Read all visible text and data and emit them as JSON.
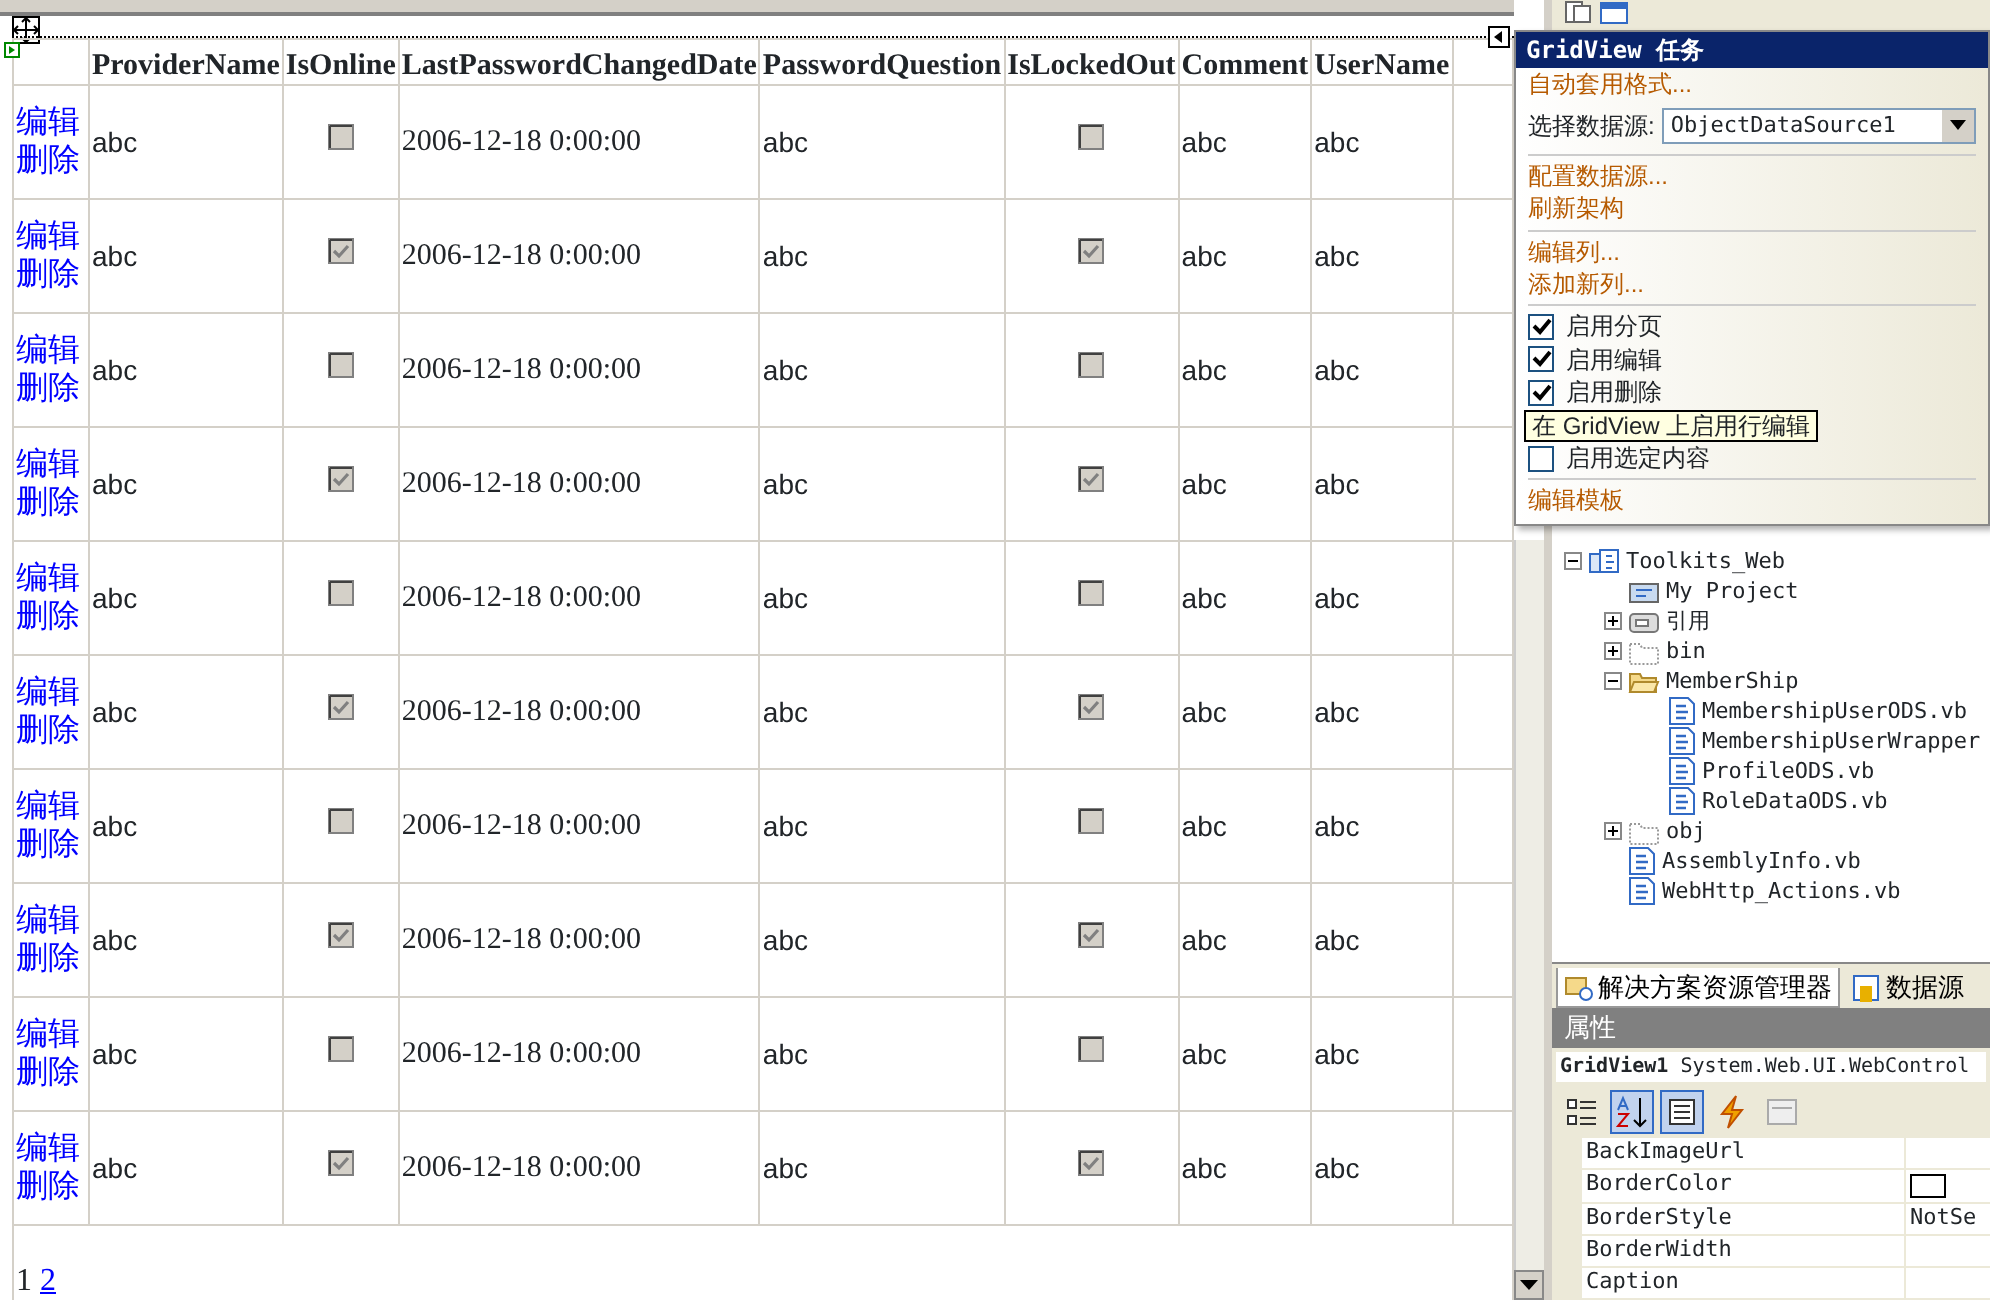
{
  "grid": {
    "columns": [
      "ProviderName",
      "IsOnline",
      "LastPasswordChangedDate",
      "PasswordQuestion",
      "IsLockedOut",
      "Comment",
      "UserName"
    ],
    "rows": [
      {
        "edit_link": "编辑",
        "delete_link": "删除",
        "provider_name": "abc",
        "is_online": false,
        "last_password_changed_date": "2006-12-18 0:00:00",
        "password_question": "abc",
        "is_locked_out": false,
        "comment": "abc",
        "user_name": "abc"
      },
      {
        "edit_link": "编辑",
        "delete_link": "删除",
        "provider_name": "abc",
        "is_online": true,
        "last_password_changed_date": "2006-12-18 0:00:00",
        "password_question": "abc",
        "is_locked_out": true,
        "comment": "abc",
        "user_name": "abc"
      },
      {
        "edit_link": "编辑",
        "delete_link": "删除",
        "provider_name": "abc",
        "is_online": false,
        "last_password_changed_date": "2006-12-18 0:00:00",
        "password_question": "abc",
        "is_locked_out": false,
        "comment": "abc",
        "user_name": "abc"
      },
      {
        "edit_link": "编辑",
        "delete_link": "删除",
        "provider_name": "abc",
        "is_online": true,
        "last_password_changed_date": "2006-12-18 0:00:00",
        "password_question": "abc",
        "is_locked_out": true,
        "comment": "abc",
        "user_name": "abc"
      },
      {
        "edit_link": "编辑",
        "delete_link": "删除",
        "provider_name": "abc",
        "is_online": false,
        "last_password_changed_date": "2006-12-18 0:00:00",
        "password_question": "abc",
        "is_locked_out": false,
        "comment": "abc",
        "user_name": "abc"
      },
      {
        "edit_link": "编辑",
        "delete_link": "删除",
        "provider_name": "abc",
        "is_online": true,
        "last_password_changed_date": "2006-12-18 0:00:00",
        "password_question": "abc",
        "is_locked_out": true,
        "comment": "abc",
        "user_name": "abc"
      },
      {
        "edit_link": "编辑",
        "delete_link": "删除",
        "provider_name": "abc",
        "is_online": false,
        "last_password_changed_date": "2006-12-18 0:00:00",
        "password_question": "abc",
        "is_locked_out": false,
        "comment": "abc",
        "user_name": "abc"
      },
      {
        "edit_link": "编辑",
        "delete_link": "删除",
        "provider_name": "abc",
        "is_online": true,
        "last_password_changed_date": "2006-12-18 0:00:00",
        "password_question": "abc",
        "is_locked_out": true,
        "comment": "abc",
        "user_name": "abc"
      },
      {
        "edit_link": "编辑",
        "delete_link": "删除",
        "provider_name": "abc",
        "is_online": false,
        "last_password_changed_date": "2006-12-18 0:00:00",
        "password_question": "abc",
        "is_locked_out": false,
        "comment": "abc",
        "user_name": "abc"
      },
      {
        "edit_link": "编辑",
        "delete_link": "删除",
        "provider_name": "abc",
        "is_online": true,
        "last_password_changed_date": "2006-12-18 0:00:00",
        "password_question": "abc",
        "is_locked_out": true,
        "comment": "abc",
        "user_name": "abc"
      }
    ],
    "pager": [
      {
        "label": "1",
        "selected": true
      },
      {
        "label": "2",
        "selected": false
      }
    ]
  },
  "task_panel": {
    "title": "GridView 任务",
    "items": [
      {
        "kind": "link",
        "label": "自动套用格式..."
      },
      {
        "kind": "select",
        "label": "选择数据源:",
        "value": "ObjectDataSource1"
      },
      {
        "kind": "separator"
      },
      {
        "kind": "link",
        "label": "配置数据源..."
      },
      {
        "kind": "link",
        "label": "刷新架构"
      },
      {
        "kind": "separator"
      },
      {
        "kind": "link",
        "label": "编辑列..."
      },
      {
        "kind": "link",
        "label": "添加新列..."
      },
      {
        "kind": "separator"
      },
      {
        "kind": "checkbox",
        "label": "启用分页",
        "checked": true
      },
      {
        "kind": "checkbox",
        "label": "启用编辑",
        "checked": true
      },
      {
        "kind": "checkbox",
        "label": "启用删除",
        "checked": true
      },
      {
        "kind": "tooltip",
        "label": "在 GridView 上启用行编辑"
      },
      {
        "kind": "checkbox",
        "label": "启用选定内容",
        "checked": false
      },
      {
        "kind": "separator"
      },
      {
        "kind": "link",
        "label": "编辑模板"
      }
    ]
  },
  "solution_explorer": {
    "tree": [
      {
        "kind": "project",
        "label": "Toolkits_Web",
        "expanded": true,
        "children": [
          {
            "kind": "properties",
            "label": "My Project"
          },
          {
            "kind": "references",
            "label": "引用",
            "expanded": false
          },
          {
            "kind": "folder",
            "label": "bin",
            "expanded": false
          },
          {
            "kind": "folder",
            "label": "MemberShip",
            "expanded": true,
            "children": [
              {
                "kind": "file",
                "label": "MembershipUserODS.vb"
              },
              {
                "kind": "file",
                "label": "MembershipUserWrapper"
              },
              {
                "kind": "file",
                "label": "ProfileODS.vb"
              },
              {
                "kind": "file",
                "label": "RoleDataODS.vb"
              }
            ]
          },
          {
            "kind": "folder",
            "label": "obj",
            "expanded": false
          },
          {
            "kind": "file",
            "label": "AssemblyInfo.vb"
          },
          {
            "kind": "file",
            "label": "WebHttp_Actions.vb"
          }
        ]
      }
    ],
    "tabs": [
      {
        "label": "解决方案资源管理器",
        "selected": true
      },
      {
        "label": "数据源",
        "selected": false
      }
    ]
  },
  "properties": {
    "title": "属性",
    "object_name": "GridView1",
    "object_type": "System.Web.UI.WebControl",
    "toolbar": [
      {
        "kind": "categorized",
        "selected": false
      },
      {
        "kind": "alphabetical",
        "selected": true
      },
      {
        "kind": "properties",
        "selected": true
      },
      {
        "kind": "events",
        "selected": false
      },
      {
        "kind": "pages",
        "selected": false
      }
    ],
    "rows": [
      {
        "name": "BackImageUrl"
      },
      {
        "name": "BorderColor",
        "kind": "color"
      },
      {
        "name": "BorderStyle",
        "value": "NotSe"
      },
      {
        "name": "BorderWidth"
      },
      {
        "name": "Caption"
      }
    ]
  }
}
